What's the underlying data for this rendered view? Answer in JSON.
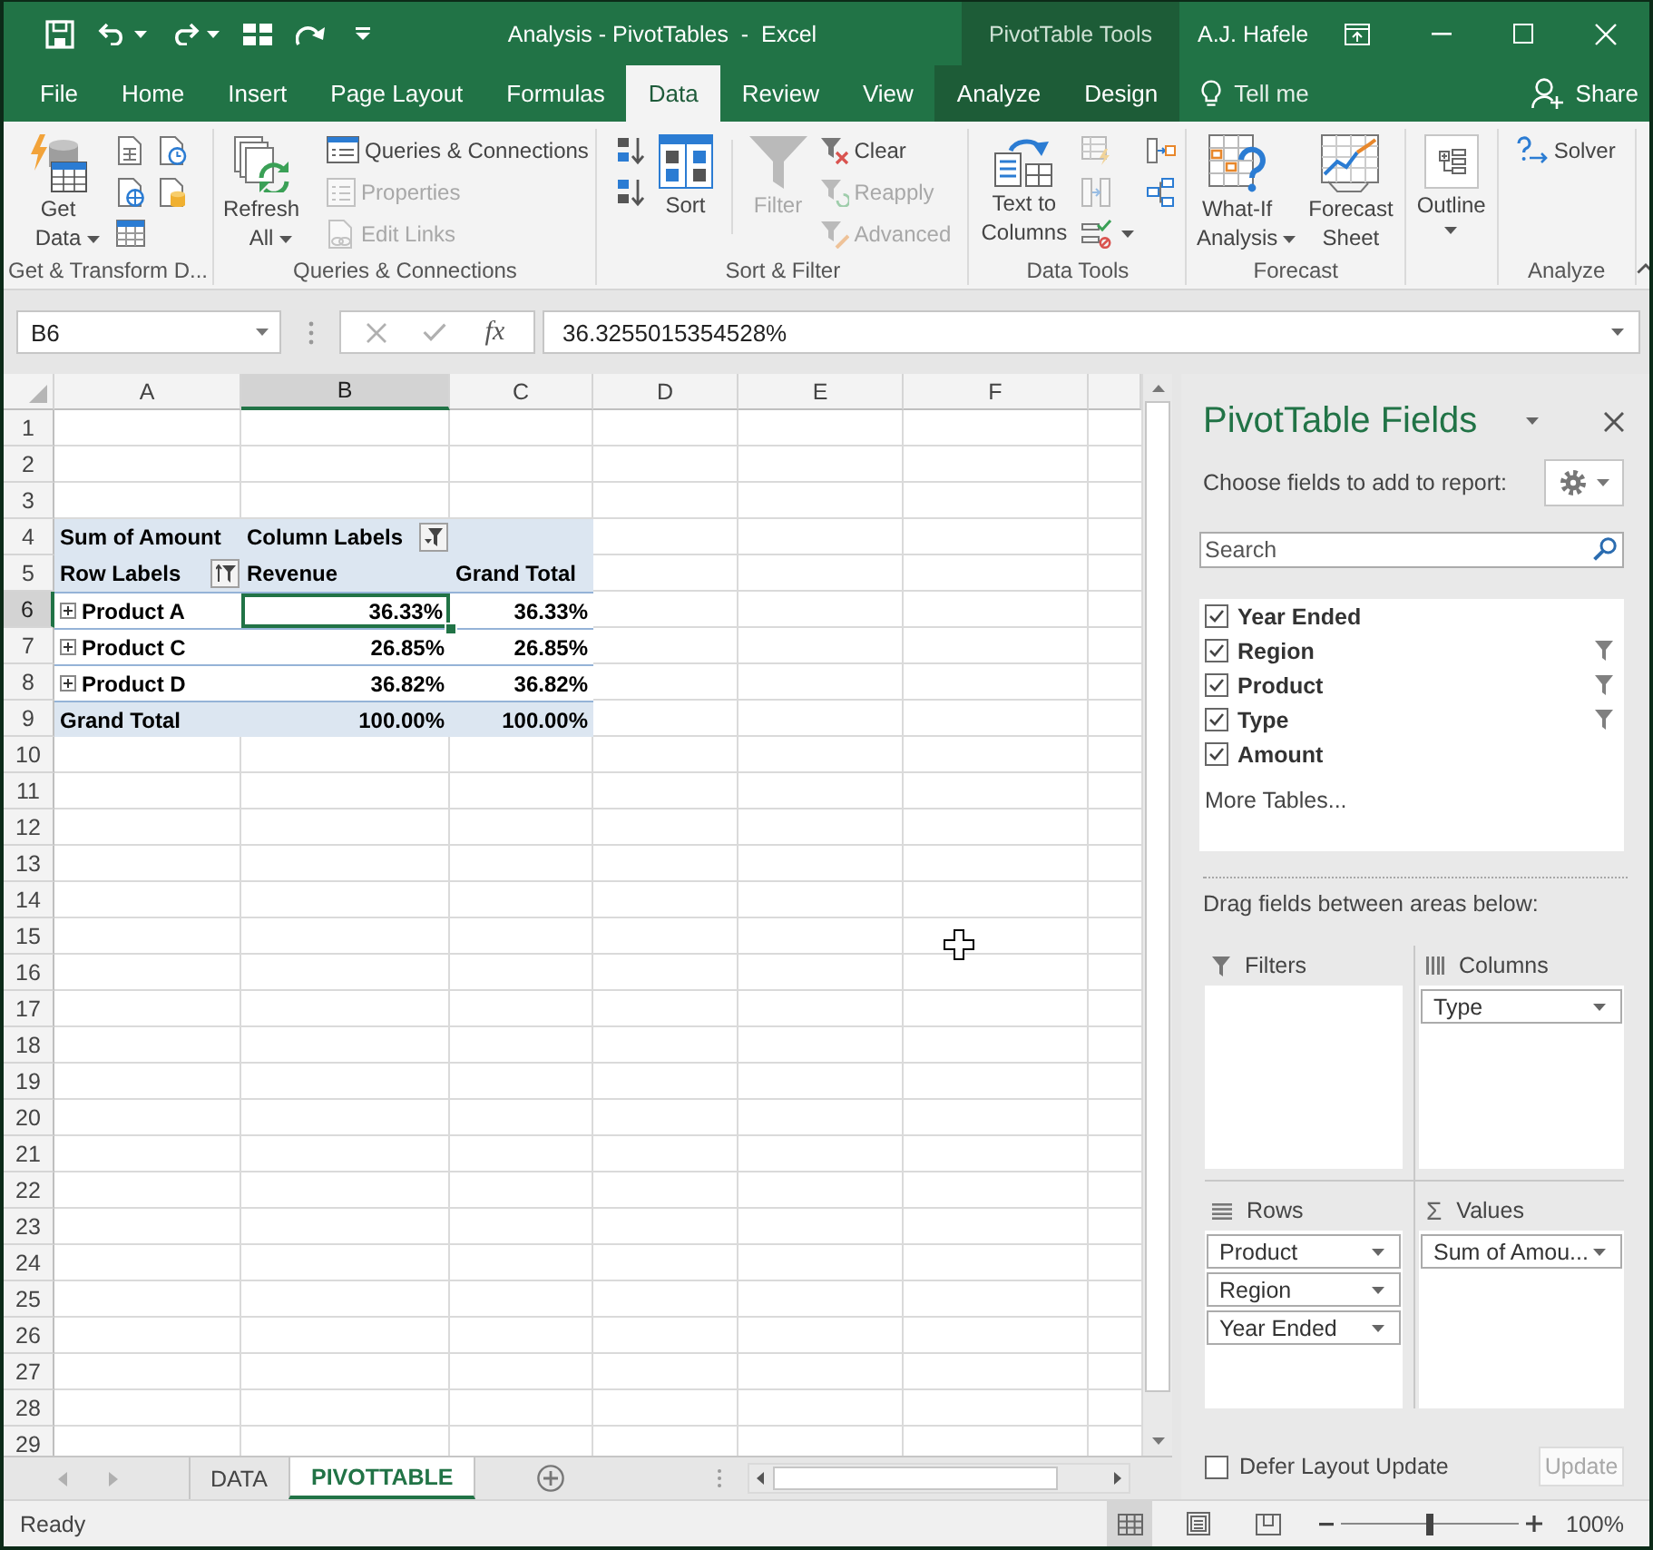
{
  "window": {
    "title": "Analysis - PivotTables  -  Excel",
    "context_title": "PivotTable Tools",
    "user": "A.J. Hafele"
  },
  "tabs": [
    {
      "label": "File",
      "selected": false,
      "contextual": false
    },
    {
      "label": "Home",
      "selected": false,
      "contextual": false
    },
    {
      "label": "Insert",
      "selected": false,
      "contextual": false
    },
    {
      "label": "Page Layout",
      "selected": false,
      "contextual": false
    },
    {
      "label": "Formulas",
      "selected": false,
      "contextual": false
    },
    {
      "label": "Data",
      "selected": true,
      "contextual": false
    },
    {
      "label": "Review",
      "selected": false,
      "contextual": false
    },
    {
      "label": "View",
      "selected": false,
      "contextual": false
    },
    {
      "label": "Analyze",
      "selected": false,
      "contextual": true
    },
    {
      "label": "Design",
      "selected": false,
      "contextual": true
    }
  ],
  "tell_me": "Tell me",
  "share": "Share",
  "ribbon": {
    "groups": [
      {
        "label": "Get & Transform D...",
        "columns": [
          {
            "items": [
              {
                "kind": "large",
                "label": "Get Data",
                "menu": true,
                "disabled": false
              }
            ]
          },
          {
            "items": [
              {
                "kind": "icon",
                "menu": false,
                "disabled": false
              },
              {
                "kind": "icon",
                "menu": false,
                "disabled": false
              },
              {
                "kind": "icon",
                "menu": false,
                "disabled": false
              }
            ]
          },
          {
            "items": [
              {
                "kind": "icon",
                "menu": false,
                "disabled": false
              },
              {
                "kind": "icon",
                "menu": false,
                "disabled": false
              }
            ]
          }
        ]
      },
      {
        "label": "Queries & Connections",
        "columns": [
          {
            "items": [
              {
                "kind": "large",
                "label": "Refresh All",
                "menu": true,
                "disabled": false
              }
            ]
          },
          {
            "items": [
              {
                "kind": "small",
                "label": "Queries & Connections",
                "menu": false,
                "disabled": false
              },
              {
                "kind": "small",
                "label": "Properties",
                "menu": false,
                "disabled": true
              },
              {
                "kind": "small",
                "label": "Edit Links",
                "menu": false,
                "disabled": true
              }
            ]
          }
        ]
      },
      {
        "label": "Sort & Filter",
        "columns": [
          {
            "items": [
              {
                "kind": "icon",
                "menu": false,
                "disabled": false
              },
              {
                "kind": "icon",
                "menu": false,
                "disabled": false
              }
            ]
          },
          {
            "items": [
              {
                "kind": "large",
                "label": "Sort",
                "menu": false,
                "disabled": false
              }
            ]
          },
          {
            "divider": true,
            "items": [
              {
                "kind": "large",
                "label": "Filter",
                "menu": false,
                "disabled": true
              }
            ]
          },
          {
            "items": [
              {
                "kind": "small",
                "label": "Clear",
                "menu": false,
                "disabled": false
              },
              {
                "kind": "small",
                "label": "Reapply",
                "menu": false,
                "disabled": true
              },
              {
                "kind": "small",
                "label": "Advanced",
                "menu": false,
                "disabled": true
              }
            ]
          }
        ]
      },
      {
        "label": "Data Tools",
        "columns": [
          {
            "items": [
              {
                "kind": "large",
                "label": "Text to Columns",
                "menu": false,
                "disabled": false
              }
            ]
          },
          {
            "items": [
              {
                "kind": "icon",
                "menu": false,
                "disabled": true
              },
              {
                "kind": "icon",
                "menu": false,
                "disabled": true
              },
              {
                "kind": "icon",
                "menu": true,
                "disabled": false
              }
            ]
          },
          {
            "items": [
              {
                "kind": "icon",
                "menu": false,
                "disabled": false
              },
              {
                "kind": "icon",
                "menu": false,
                "disabled": false
              }
            ]
          }
        ]
      },
      {
        "label": "Forecast",
        "columns": [
          {
            "items": [
              {
                "kind": "large",
                "label": "What-If Analysis",
                "menu": true,
                "disabled": false
              }
            ]
          },
          {
            "items": [
              {
                "kind": "large",
                "label": "Forecast Sheet",
                "menu": false,
                "disabled": false
              }
            ]
          }
        ]
      },
      {
        "columns": [
          {
            "items": [
              {
                "kind": "large",
                "label": "Outline",
                "menu": true,
                "disabled": false
              }
            ]
          }
        ]
      },
      {
        "label": "Analyze",
        "columns": [
          {
            "items": [
              {
                "kind": "small",
                "label": "Solver",
                "menu": false,
                "disabled": false
              }
            ]
          }
        ]
      }
    ]
  },
  "formula_bar": {
    "name_box": "B6",
    "cancel_disabled": true,
    "enter_disabled": true,
    "function_label": "fx",
    "formula": "36.3255015354528%"
  },
  "sheet": {
    "columns": [
      {
        "label": "A",
        "selected": false
      },
      {
        "label": "B",
        "selected": true
      },
      {
        "label": "C",
        "selected": false
      },
      {
        "label": "D",
        "selected": false
      },
      {
        "label": "E",
        "selected": false
      },
      {
        "label": "F",
        "selected": false
      }
    ],
    "rows": [
      {
        "label": "1",
        "selected": false,
        "kind": "plain"
      },
      {
        "label": "2",
        "selected": false,
        "kind": "plain"
      },
      {
        "label": "3",
        "selected": false,
        "kind": "plain"
      },
      {
        "label": "4",
        "selected": false,
        "kind": "header",
        "cells": [
          {
            "text": "Sum of Amount",
            "kind": "label",
            "selected": false
          },
          {
            "text": "Column Labels",
            "kind": "label",
            "selected": false,
            "button": {
              "kind": "filter"
            }
          }
        ]
      },
      {
        "label": "5",
        "selected": false,
        "kind": "header",
        "cells": [
          {
            "text": "Row Labels",
            "kind": "label",
            "selected": false,
            "button": {
              "kind": "sort-filter"
            }
          },
          {
            "text": "Revenue",
            "kind": "label",
            "selected": false
          },
          {
            "text": "Grand Total",
            "kind": "label",
            "selected": false
          }
        ]
      },
      {
        "label": "6",
        "selected": true,
        "kind": "item",
        "cells": [
          {
            "text": "Product A",
            "kind": "item",
            "selected": false
          },
          {
            "text": "36.33%",
            "kind": "value",
            "selected": true
          },
          {
            "text": "36.33%",
            "kind": "value",
            "selected": false
          }
        ]
      },
      {
        "label": "7",
        "selected": false,
        "kind": "item",
        "cells": [
          {
            "text": "Product C",
            "kind": "item",
            "selected": false
          },
          {
            "text": "26.85%",
            "kind": "value",
            "selected": false
          },
          {
            "text": "26.85%",
            "kind": "value",
            "selected": false
          }
        ]
      },
      {
        "label": "8",
        "selected": false,
        "kind": "item",
        "cells": [
          {
            "text": "Product D",
            "kind": "item",
            "selected": false
          },
          {
            "text": "36.82%",
            "kind": "value",
            "selected": false
          },
          {
            "text": "36.82%",
            "kind": "value",
            "selected": false
          }
        ]
      },
      {
        "label": "9",
        "selected": false,
        "kind": "total",
        "cells": [
          {
            "text": "Grand Total",
            "kind": "label",
            "selected": false
          },
          {
            "text": "100.00%",
            "kind": "value",
            "selected": false
          },
          {
            "text": "100.00%",
            "kind": "value",
            "selected": false
          }
        ]
      },
      {
        "label": "10",
        "selected": false,
        "kind": "plain"
      },
      {
        "label": "11",
        "selected": false,
        "kind": "plain"
      },
      {
        "label": "12",
        "selected": false,
        "kind": "plain"
      },
      {
        "label": "13",
        "selected": false,
        "kind": "plain"
      },
      {
        "label": "14",
        "selected": false,
        "kind": "plain"
      },
      {
        "label": "15",
        "selected": false,
        "kind": "plain"
      },
      {
        "label": "16",
        "selected": false,
        "kind": "plain"
      },
      {
        "label": "17",
        "selected": false,
        "kind": "plain"
      },
      {
        "label": "18",
        "selected": false,
        "kind": "plain"
      },
      {
        "label": "19",
        "selected": false,
        "kind": "plain"
      },
      {
        "label": "20",
        "selected": false,
        "kind": "plain"
      },
      {
        "label": "21",
        "selected": false,
        "kind": "plain"
      },
      {
        "label": "22",
        "selected": false,
        "kind": "plain"
      },
      {
        "label": "23",
        "selected": false,
        "kind": "plain"
      },
      {
        "label": "24",
        "selected": false,
        "kind": "plain"
      },
      {
        "label": "25",
        "selected": false,
        "kind": "plain"
      },
      {
        "label": "26",
        "selected": false,
        "kind": "plain"
      },
      {
        "label": "27",
        "selected": false,
        "kind": "plain"
      },
      {
        "label": "28",
        "selected": false,
        "kind": "plain"
      },
      {
        "label": "29",
        "selected": false,
        "kind": "plain"
      }
    ]
  },
  "sheet_tabs": [
    {
      "label": "DATA",
      "selected": false
    },
    {
      "label": "PIVOTTABLE",
      "selected": true
    }
  ],
  "pivot_fields": {
    "title": "PivotTable Fields",
    "subtitle": "Choose fields to add to report:",
    "search": {
      "placeholder": "Search"
    },
    "fields": [
      {
        "label": "Year Ended",
        "checked": true,
        "filtered": false
      },
      {
        "label": "Region",
        "checked": true,
        "filtered": true
      },
      {
        "label": "Product",
        "checked": true,
        "filtered": true
      },
      {
        "label": "Type",
        "checked": true,
        "filtered": true
      },
      {
        "label": "Amount",
        "checked": true,
        "filtered": false
      }
    ],
    "more_tables": "More Tables...",
    "areas_hint": "Drag fields between areas below:",
    "areas": [
      {
        "label": "Filters"
      },
      {
        "label": "Columns",
        "fields": [
          "Type"
        ]
      },
      {
        "label": "Rows",
        "fields": [
          "Product",
          "Region",
          "Year Ended"
        ]
      },
      {
        "label": "Values",
        "symbol": "Σ",
        "fields": [
          "Sum of Amou..."
        ]
      }
    ],
    "defer": {
      "label": "Defer Layout Update",
      "checked": false
    },
    "update": {
      "label": "Update",
      "disabled": true
    }
  },
  "status_bar": {
    "text": "Ready",
    "views": [
      {
        "selected": true
      },
      {
        "selected": false
      },
      {
        "selected": false
      }
    ],
    "zoom": {
      "level": 0.5,
      "reading": "100%"
    }
  }
}
